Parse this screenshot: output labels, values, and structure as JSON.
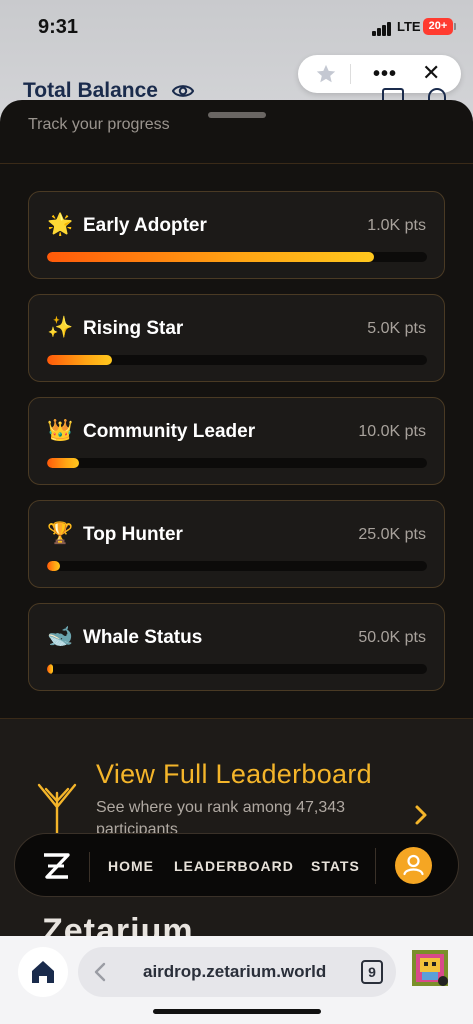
{
  "status_bar": {
    "time": "9:31",
    "network": "LTE",
    "battery": "20+"
  },
  "mini_app_pill": {
    "more_label": "•••",
    "close_label": "✕"
  },
  "header": {
    "total_balance_label": "Total Balance"
  },
  "sheet": {
    "subtitle": "Track your progress",
    "achievements": [
      {
        "emoji": "🌟",
        "title": "Early Adopter",
        "points": "1.0K pts",
        "progress": 0.86
      },
      {
        "emoji": "✨",
        "title": "Rising Star",
        "points": "5.0K pts",
        "progress": 0.17
      },
      {
        "emoji": "👑",
        "title": "Community Leader",
        "points": "10.0K pts",
        "progress": 0.085
      },
      {
        "emoji": "🏆",
        "title": "Top Hunter",
        "points": "25.0K pts",
        "progress": 0.034
      },
      {
        "emoji": "🐋",
        "title": "Whale Status",
        "points": "50.0K pts",
        "progress": 0.017
      }
    ],
    "leaderboard": {
      "title": "View Full Leaderboard",
      "description": "See where you rank among 47,343 participants"
    }
  },
  "nav": {
    "logo_text": "Z",
    "items": [
      "HOME",
      "LEADERBOARD",
      "STATS"
    ]
  },
  "brand_peek": "Zetarium",
  "browser": {
    "url": "airdrop.zetarium.world",
    "tab_count": "9"
  },
  "colors": {
    "accent": "#f5a623",
    "gold_text": "#f4b52a",
    "card_border": "#4a3a24",
    "sheet_bg": "#141210"
  }
}
